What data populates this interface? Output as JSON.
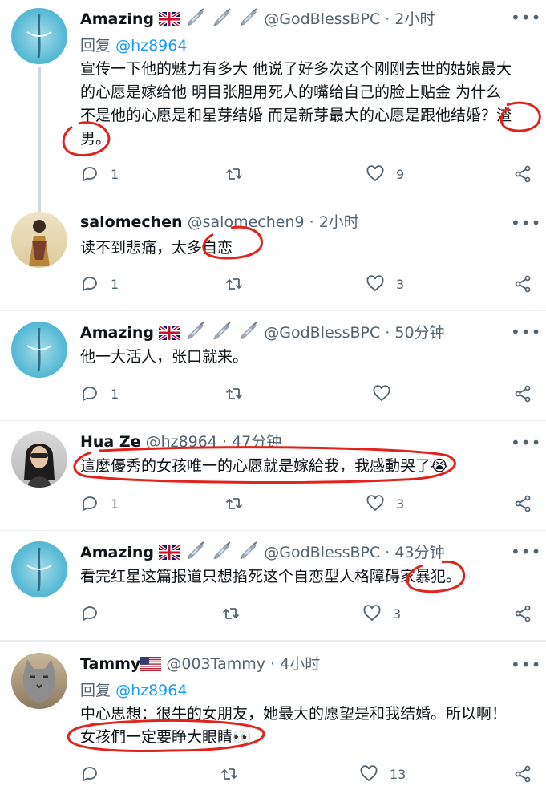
{
  "tweets": [
    {
      "name": "Amazing",
      "emoji_badges": [
        "uk-flag",
        "syringe",
        "syringe",
        "syringe"
      ],
      "handle": "@GodBlessBPC",
      "time": "2小时",
      "reply_prefix": "回复",
      "reply_handle": "@hz8964",
      "text_lines": [
        "宣传一下他的魅力有多大 他说了好多次这个刚刚去世的姑娘最大",
        "的心愿是嫁给他 明目张胆用死人的嘴给自己的脸上贴金 为什么",
        "不是他的心愿是和星芽结婚 而是新芽最大的心愿是跟他结婚？渣",
        "男。"
      ],
      "replies": "1",
      "retweets": "",
      "likes": "9"
    },
    {
      "name": "salomechen",
      "handle": "@salomechen9",
      "time": "2小时",
      "text_lines": [
        "读不到悲痛，太多自恋"
      ],
      "replies": "1",
      "retweets": "",
      "likes": "3"
    },
    {
      "name": "Amazing",
      "emoji_badges": [
        "uk-flag",
        "syringe",
        "syringe",
        "syringe"
      ],
      "handle": "@GodBlessBPC",
      "time": "50分钟",
      "text_lines": [
        "他一大活人，张口就来。"
      ],
      "replies": "1",
      "retweets": "",
      "likes": ""
    },
    {
      "name": "Hua Ze",
      "handle": "@hz8964",
      "time": "47分钟",
      "text_lines": [
        "這麼優秀的女孩唯一的心愿就是嫁給我，我感動哭了😭"
      ],
      "replies": "1",
      "retweets": "",
      "likes": "3"
    },
    {
      "name": "Amazing",
      "emoji_badges": [
        "uk-flag",
        "syringe",
        "syringe",
        "syringe"
      ],
      "handle": "@GodBlessBPC",
      "time": "43分钟",
      "text_lines": [
        "看完红星这篇报道只想掐死这个自恋型人格障碍家暴犯。"
      ],
      "replies": "",
      "retweets": "",
      "likes": "3"
    },
    {
      "name": "Tammy",
      "emoji_badges": [
        "us-flag"
      ],
      "handle": "@003Tammy",
      "time": "4小时",
      "reply_prefix": "回复",
      "reply_handle": "@hz8964",
      "text_lines": [
        "中心思想：很牛的女朋友，她最大的愿望是和我结婚。所以啊！",
        "女孩們一定要睁大眼睛👀"
      ],
      "replies": "",
      "retweets": "",
      "likes": "13"
    }
  ],
  "colors": {
    "text": "#0f1419",
    "secondary": "#536471",
    "link": "#1d9bf0",
    "thread_line": "#cfd9de",
    "annotation": "#e0231c"
  },
  "icons": [
    "more-icon",
    "reply-icon",
    "retweet-icon",
    "like-icon",
    "share-icon"
  ]
}
